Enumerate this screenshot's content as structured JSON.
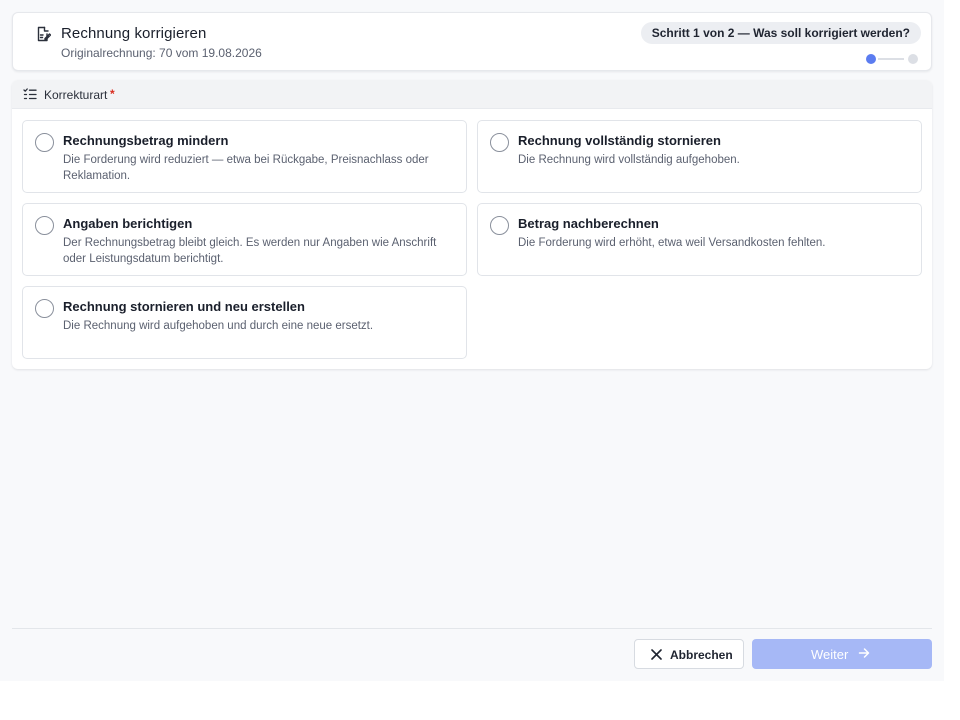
{
  "header": {
    "title": "Rechnung korrigieren",
    "subtitle": "Originalrechnung: 70 vom 19.08.2026",
    "step_label": "Schritt 1 von 2 — Was soll korrigiert werden?",
    "steps_total": 2,
    "steps_current": 1,
    "icon": "document-edit-icon"
  },
  "section": {
    "label": "Korrekturart",
    "required_mark": "*",
    "icon": "checklist-icon"
  },
  "options": [
    {
      "title": "Rechnungsbetrag mindern",
      "description": "Die Forderung wird reduziert — etwa bei Rückgabe, Preisnachlass oder Reklamation.",
      "selected": false
    },
    {
      "title": "Rechnung vollständig stornieren",
      "description": "Die Rechnung wird vollständig aufgehoben.",
      "selected": false
    },
    {
      "title": "Angaben berichtigen",
      "description": "Der Rechnungsbetrag bleibt gleich. Es werden nur Angaben wie Anschrift oder Leistungsdatum berichtigt.",
      "selected": false
    },
    {
      "title": "Betrag nachberechnen",
      "description": "Die Forderung wird erhöht, etwa weil Versandkosten fehlten.",
      "selected": false
    },
    {
      "title": "Rechnung stornieren und neu erstellen",
      "description": "Die Rechnung wird aufgehoben und durch eine neue ersetzt.",
      "selected": false
    }
  ],
  "footer": {
    "cancel_label": "Abbrechen",
    "next_label": "Weiter",
    "cancel_icon": "close-icon",
    "next_icon": "arrow-right-icon",
    "next_disabled": true
  },
  "colors": {
    "accent": "#5b7cf0",
    "accent_disabled": "#a6b8f6",
    "required": "#d92d20"
  }
}
